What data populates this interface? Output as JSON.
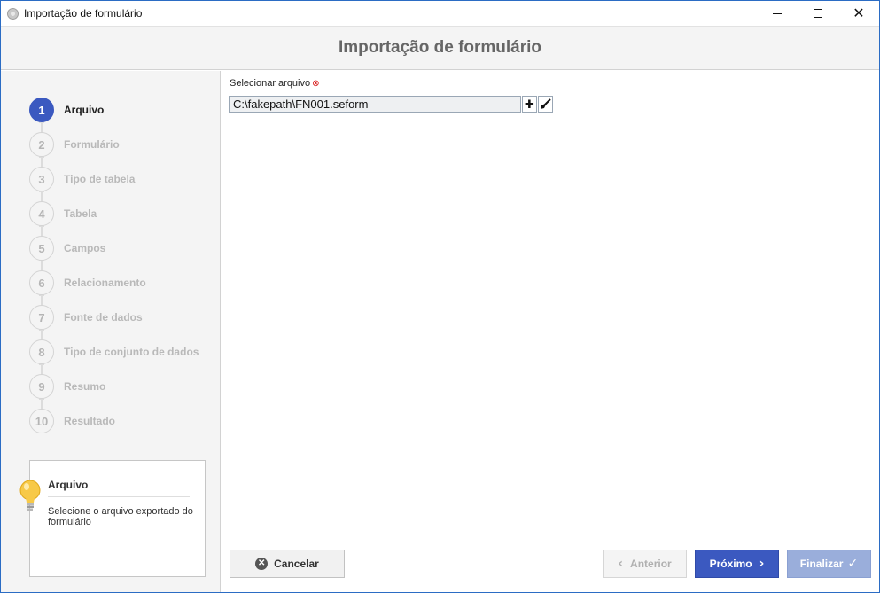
{
  "window": {
    "title": "Importação de formulário"
  },
  "header": {
    "title": "Importação de formulário"
  },
  "steps": [
    {
      "number": "1",
      "label": "Arquivo",
      "active": true
    },
    {
      "number": "2",
      "label": "Formulário",
      "active": false
    },
    {
      "number": "3",
      "label": "Tipo de tabela",
      "active": false
    },
    {
      "number": "4",
      "label": "Tabela",
      "active": false
    },
    {
      "number": "5",
      "label": "Campos",
      "active": false
    },
    {
      "number": "6",
      "label": "Relacionamento",
      "active": false
    },
    {
      "number": "7",
      "label": "Fonte de dados",
      "active": false
    },
    {
      "number": "8",
      "label": "Tipo de conjunto de dados",
      "active": false
    },
    {
      "number": "9",
      "label": "Resumo",
      "active": false
    },
    {
      "number": "10",
      "label": "Resultado",
      "active": false
    }
  ],
  "help": {
    "title": "Arquivo",
    "text": "Selecione o arquivo exportado do formulário",
    "icon": "lightbulb-icon"
  },
  "form": {
    "file_label": "Selecionar arquivo",
    "required_marker": "⊗",
    "file_value": "C:\\fakepath\\FN001.seform",
    "add_icon": "plus-icon",
    "clear_icon": "broom-icon"
  },
  "footer": {
    "cancel_label": "Cancelar",
    "prev_label": "Anterior",
    "next_label": "Próximo",
    "finish_label": "Finalizar"
  },
  "colors": {
    "accent": "#3b59c0",
    "accent_disabled": "#9aaedb",
    "step_inactive": "#b9b9b9",
    "required": "#d40000"
  }
}
